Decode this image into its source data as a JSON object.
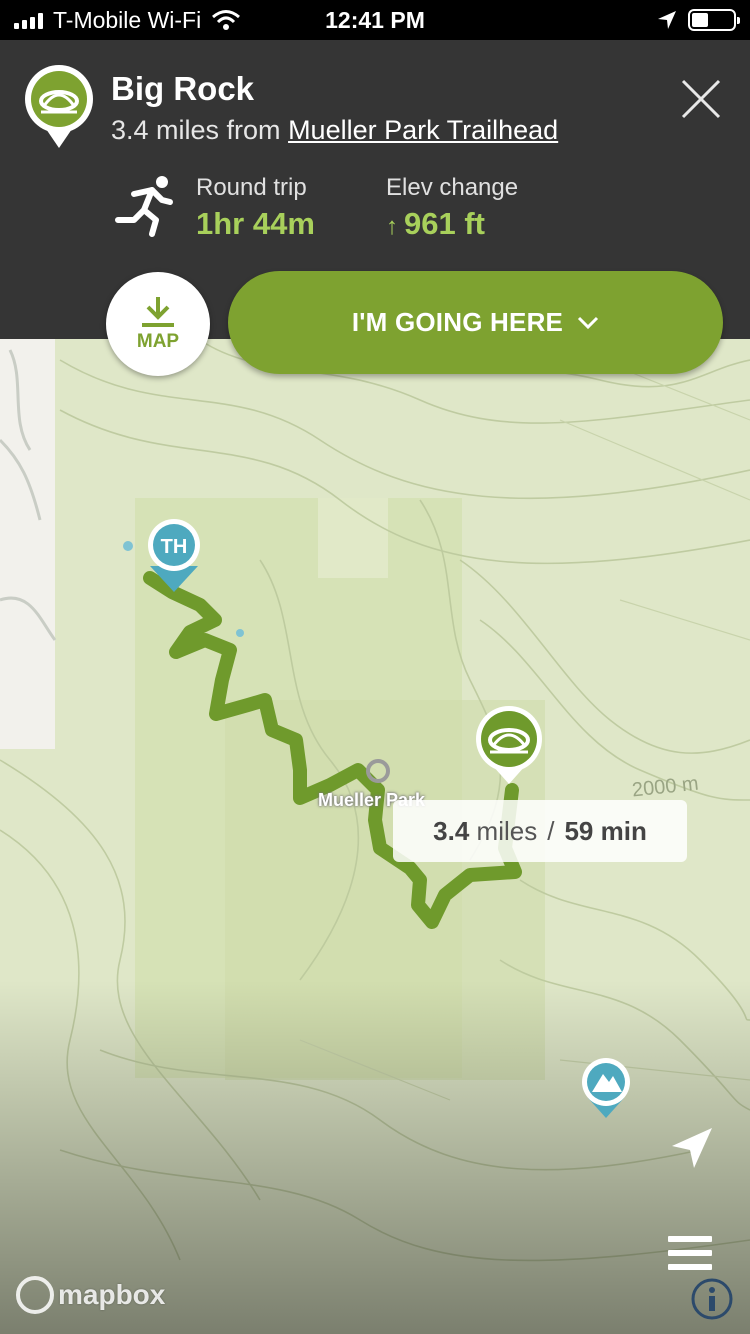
{
  "status_bar": {
    "carrier": "T-Mobile Wi-Fi",
    "time": "12:41 PM"
  },
  "place": {
    "name": "Big Rock",
    "distance_prefix": "3.4 miles from",
    "trailhead": "Mueller Park Trailhead"
  },
  "stats": {
    "round_trip_label": "Round trip",
    "round_trip_value": "1hr 44m",
    "elev_label": "Elev change",
    "elev_arrow": "↑",
    "elev_value": "961 ft"
  },
  "buttons": {
    "map_download_label": "MAP",
    "going_label": "I'M GOING HERE"
  },
  "map": {
    "trailhead_marker_label": "TH",
    "park_label": "Mueller Park",
    "elevation_label": "2000 m",
    "route_distance": "3.4",
    "route_distance_unit": "miles",
    "route_separator": "/",
    "route_time": "59 min",
    "attribution": "mapbox"
  },
  "colors": {
    "accent_green": "#7ea230",
    "stat_green": "#a8d05b",
    "panel_bg": "#353535",
    "marker_blue": "#4ea9bf",
    "route_green": "#6f9a2c"
  },
  "icons": {
    "place": "big-rock-marker-icon",
    "close": "close-icon",
    "activity": "running-person-icon",
    "download": "download-icon",
    "dropdown": "chevron-down-icon",
    "locate": "location-arrow-icon",
    "menu": "hamburger-menu-icon",
    "info": "info-icon"
  }
}
